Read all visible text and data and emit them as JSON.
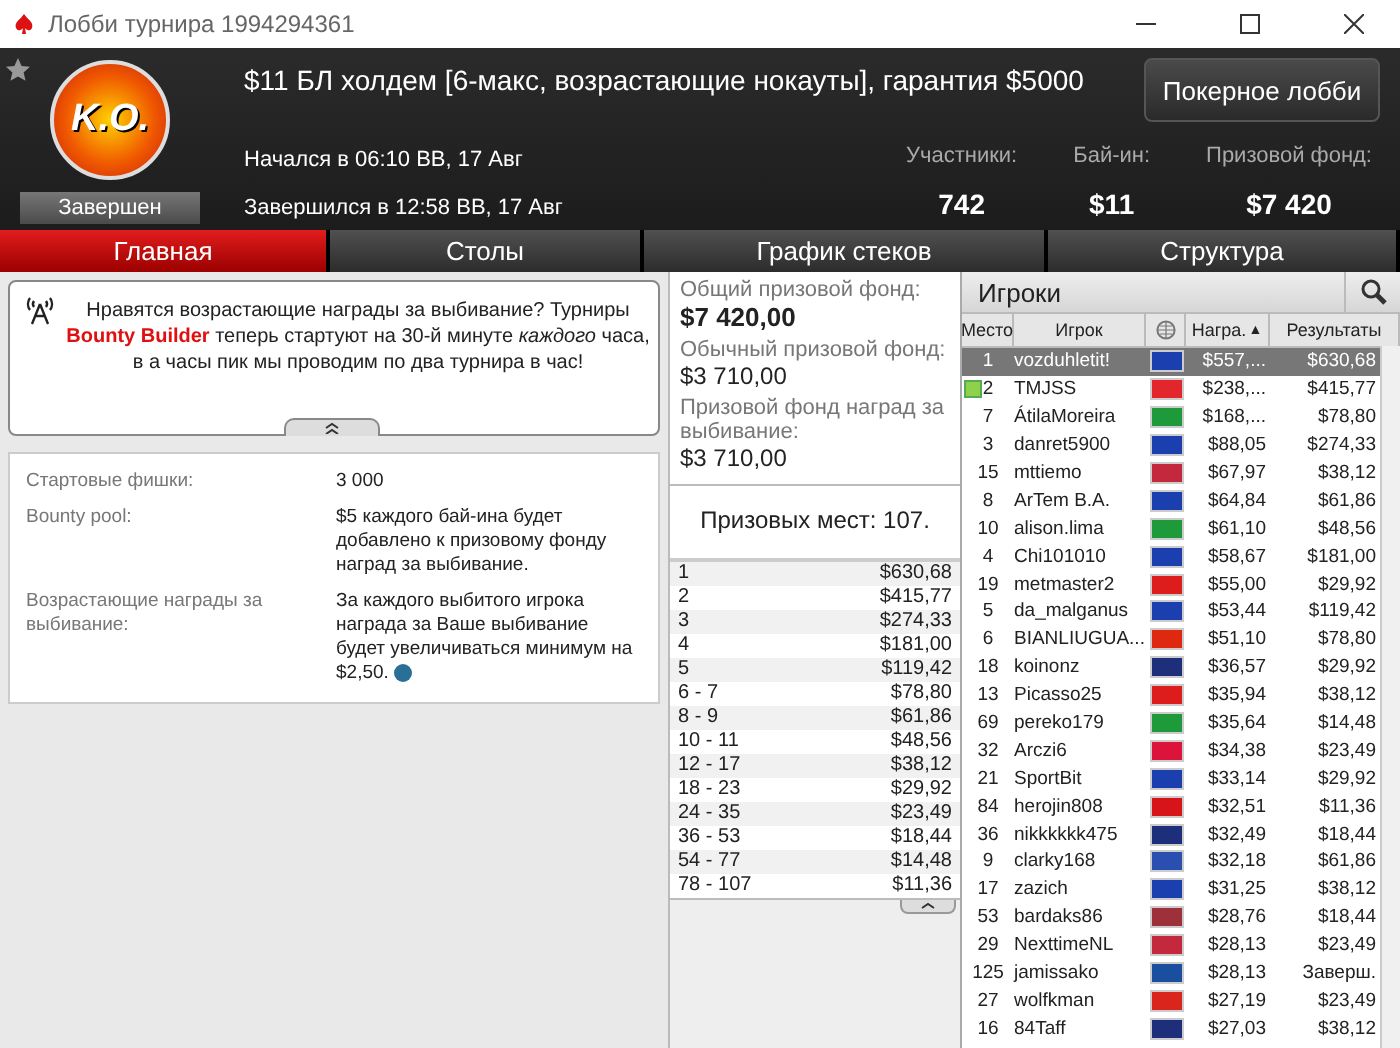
{
  "window": {
    "title": "Лобби турнира 1994294361"
  },
  "header": {
    "logo_text": "K.O.",
    "status": "Завершен",
    "title": "$11 БЛ холдем [6-макс, возрастающие нокауты], гарантия $5000",
    "lobby_button": "Покерное лобби",
    "started": "Начался в 06:10 ВВ, 17 Авг",
    "finished": "Завершился в 12:58 ВВ, 17 Авг",
    "stats": [
      {
        "label": "Участники:",
        "value": "742"
      },
      {
        "label": "Бай-ин:",
        "value": "$11"
      },
      {
        "label": "Призовой фонд:",
        "value": "$7 420"
      }
    ]
  },
  "tabs": [
    {
      "label": "Главная",
      "selected": true
    },
    {
      "label": "Столы",
      "selected": false
    },
    {
      "label": "График стеков",
      "selected": false
    },
    {
      "label": "Структура",
      "selected": false
    }
  ],
  "announcement": {
    "text": "Нравятся возрастающие награды за выбивание? Турниры **Bounty Builder** теперь стартуют на 30-й минуте *каждого* часа, в а часы пик мы проводим по два турнира в час!"
  },
  "details": [
    {
      "label": "Стартовые фишки:",
      "value": "3 000",
      "info": false
    },
    {
      "label": "Bounty pool:",
      "value": "$5 каждого бай-ина будет добавлено к призовому фонду наград за выбивание.",
      "info": false
    },
    {
      "label": "Возрастающие награды за выбивание:",
      "value": "За каждого выбитого игрока награда за Ваше выбивание будет увеличиваться минимум на $2,50.",
      "info": true
    }
  ],
  "prize_pool": [
    {
      "label": "Общий призовой фонд:",
      "value": "$7 420,00"
    },
    {
      "label": "Обычный призовой фонд:",
      "value": "$3 710,00"
    },
    {
      "label": "Призовой фонд наград за выбивание:",
      "value": "$3 710,00"
    }
  ],
  "paid_places": "Призовых мест: 107.",
  "payouts": [
    [
      "1",
      "$630,68"
    ],
    [
      "2",
      "$415,77"
    ],
    [
      "3",
      "$274,33"
    ],
    [
      "4",
      "$181,00"
    ],
    [
      "5",
      "$119,42"
    ],
    [
      "6 - 7",
      "$78,80"
    ],
    [
      "8 - 9",
      "$61,86"
    ],
    [
      "10 - 11",
      "$48,56"
    ],
    [
      "12 - 17",
      "$38,12"
    ],
    [
      "18 - 23",
      "$29,92"
    ],
    [
      "24 - 35",
      "$23,49"
    ],
    [
      "36 - 53",
      "$18,44"
    ],
    [
      "54 - 77",
      "$14,48"
    ],
    [
      "78 - 107",
      "$11,36"
    ]
  ],
  "players": {
    "title": "Игроки",
    "columns": [
      "Место",
      "Игрок",
      "Награ.",
      "Результаты"
    ],
    "sort_mark": "▲",
    "rows": [
      {
        "place": "1",
        "name": "vozduhletit!",
        "color": "#1c3fb0",
        "bounty": "$557,...",
        "result": "$630,68",
        "selected": true,
        "marked": false
      },
      {
        "place": "2",
        "name": "TMJSS",
        "color": "#e3262b",
        "bounty": "$238,...",
        "result": "$415,77",
        "selected": false,
        "marked": true
      },
      {
        "place": "7",
        "name": "ÁtilaMoreira",
        "color": "#1f9a3a",
        "bounty": "$168,...",
        "result": "$78,80",
        "selected": false,
        "marked": false
      },
      {
        "place": "3",
        "name": "danret5900",
        "color": "#1c3fb0",
        "bounty": "$88,05",
        "result": "$274,33",
        "selected": false,
        "marked": false
      },
      {
        "place": "15",
        "name": "mttiemo",
        "color": "#c4283c",
        "bounty": "$67,97",
        "result": "$38,12",
        "selected": false,
        "marked": false
      },
      {
        "place": "8",
        "name": "ArTem B.A.",
        "color": "#1c3fb0",
        "bounty": "$64,84",
        "result": "$61,86",
        "selected": false,
        "marked": false
      },
      {
        "place": "10",
        "name": "alison.lima",
        "color": "#1f9a3a",
        "bounty": "$61,10",
        "result": "$48,56",
        "selected": false,
        "marked": false
      },
      {
        "place": "4",
        "name": "Chi101010",
        "color": "#1c3fb0",
        "bounty": "$58,67",
        "result": "$181,00",
        "selected": false,
        "marked": false
      },
      {
        "place": "19",
        "name": "metmaster2",
        "color": "#dd1c1c",
        "bounty": "$55,00",
        "result": "$29,92",
        "selected": false,
        "marked": false
      },
      {
        "place": "5",
        "name": "da_malganus",
        "color": "#1c3fb0",
        "bounty": "$53,44",
        "result": "$119,42",
        "selected": false,
        "marked": false
      },
      {
        "place": "6",
        "name": "BIANLIUGUA...",
        "color": "#de2910",
        "bounty": "$51,10",
        "result": "$78,80",
        "selected": false,
        "marked": false
      },
      {
        "place": "18",
        "name": "koinonz",
        "color": "#1d2f7a",
        "bounty": "$36,57",
        "result": "$29,92",
        "selected": false,
        "marked": false
      },
      {
        "place": "13",
        "name": "Picasso25",
        "color": "#dd1c1c",
        "bounty": "$35,94",
        "result": "$38,12",
        "selected": false,
        "marked": false
      },
      {
        "place": "69",
        "name": "pereko179",
        "color": "#1f9a3a",
        "bounty": "$35,64",
        "result": "$14,48",
        "selected": false,
        "marked": false
      },
      {
        "place": "32",
        "name": "Arczi6",
        "color": "#dc143c",
        "bounty": "$34,38",
        "result": "$23,49",
        "selected": false,
        "marked": false
      },
      {
        "place": "21",
        "name": "SportBit",
        "color": "#1c3fb0",
        "bounty": "$33,14",
        "result": "$29,92",
        "selected": false,
        "marked": false
      },
      {
        "place": "84",
        "name": "herojin808",
        "color": "#d7141a",
        "bounty": "$32,51",
        "result": "$11,36",
        "selected": false,
        "marked": false
      },
      {
        "place": "36",
        "name": "nikkkkkk475",
        "color": "#1d2f7a",
        "bounty": "$32,49",
        "result": "$18,44",
        "selected": false,
        "marked": false
      },
      {
        "place": "9",
        "name": "clarky168",
        "color": "#2a4fb0",
        "bounty": "$32,18",
        "result": "$61,86",
        "selected": false,
        "marked": false
      },
      {
        "place": "17",
        "name": "zazich",
        "color": "#1c3fb0",
        "bounty": "$31,25",
        "result": "$38,12",
        "selected": false,
        "marked": false
      },
      {
        "place": "53",
        "name": "bardaks86",
        "color": "#9e3039",
        "bounty": "$28,76",
        "result": "$18,44",
        "selected": false,
        "marked": false
      },
      {
        "place": "29",
        "name": "NexttimeNL",
        "color": "#c4283c",
        "bounty": "$28,13",
        "result": "$23,49",
        "selected": false,
        "marked": false
      },
      {
        "place": "125",
        "name": "jamissako",
        "color": "#1a4fa0",
        "bounty": "$28,13",
        "result": "Заверш.",
        "selected": false,
        "marked": false
      },
      {
        "place": "27",
        "name": "wolfkman",
        "color": "#da251d",
        "bounty": "$27,19",
        "result": "$23,49",
        "selected": false,
        "marked": false
      },
      {
        "place": "16",
        "name": "84Taff",
        "color": "#1d2f7a",
        "bounty": "$27,03",
        "result": "$38,12",
        "selected": false,
        "marked": false
      }
    ]
  }
}
